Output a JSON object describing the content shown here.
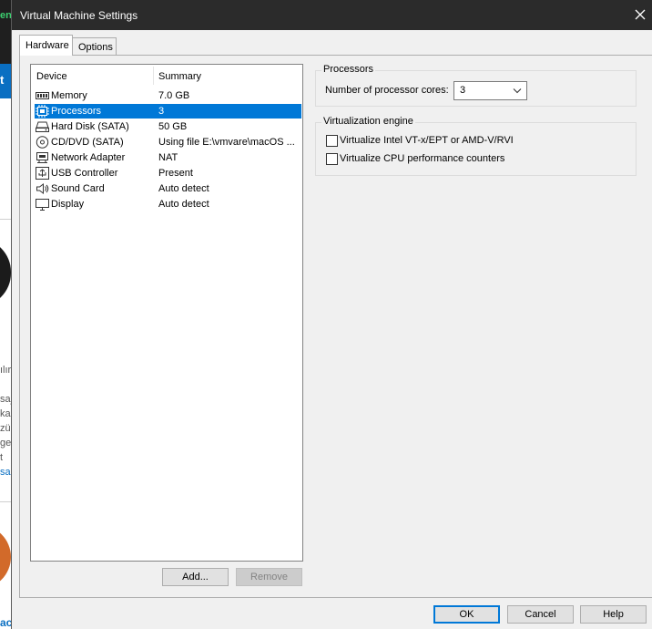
{
  "window": {
    "title": "Virtual Machine Settings"
  },
  "tabs": [
    {
      "label": "Hardware",
      "active": true
    },
    {
      "label": "Options",
      "active": false
    }
  ],
  "device_list": {
    "columns": [
      "Device",
      "Summary"
    ],
    "rows": [
      {
        "icon": "memory-icon",
        "name": "Memory",
        "summary": "7.0 GB",
        "selected": false
      },
      {
        "icon": "processor-icon",
        "name": "Processors",
        "summary": "3",
        "selected": true
      },
      {
        "icon": "hard-disk-icon",
        "name": "Hard Disk (SATA)",
        "summary": "50 GB",
        "selected": false
      },
      {
        "icon": "cd-dvd-icon",
        "name": "CD/DVD (SATA)",
        "summary": "Using file E:\\vmvare\\macOS ...",
        "selected": false
      },
      {
        "icon": "network-adapter-icon",
        "name": "Network Adapter",
        "summary": "NAT",
        "selected": false
      },
      {
        "icon": "usb-icon",
        "name": "USB Controller",
        "summary": "Present",
        "selected": false
      },
      {
        "icon": "sound-card-icon",
        "name": "Sound Card",
        "summary": "Auto detect",
        "selected": false
      },
      {
        "icon": "display-icon",
        "name": "Display",
        "summary": "Auto detect",
        "selected": false
      }
    ]
  },
  "list_buttons": {
    "add": "Add...",
    "remove": "Remove"
  },
  "processors": {
    "legend": "Processors",
    "cores_label": "Number of processor cores:",
    "cores_value": "3"
  },
  "virtualization": {
    "legend": "Virtualization engine",
    "options": [
      {
        "label": "Virtualize Intel VT-x/EPT or AMD-V/RVI",
        "checked": false
      },
      {
        "label": "Virtualize CPU performance counters",
        "checked": false
      }
    ]
  },
  "footer": {
    "ok": "OK",
    "cancel": "Cancel",
    "help": "Help"
  },
  "accent_color": "#0078d7",
  "background_window": {
    "top_fragment": "en",
    "blue_fragment": "t",
    "text_fragments": [
      "ılır",
      "saj",
      "ka",
      "zür",
      "ge",
      "t",
      "sal"
    ],
    "bottom_fragment": "ac"
  }
}
